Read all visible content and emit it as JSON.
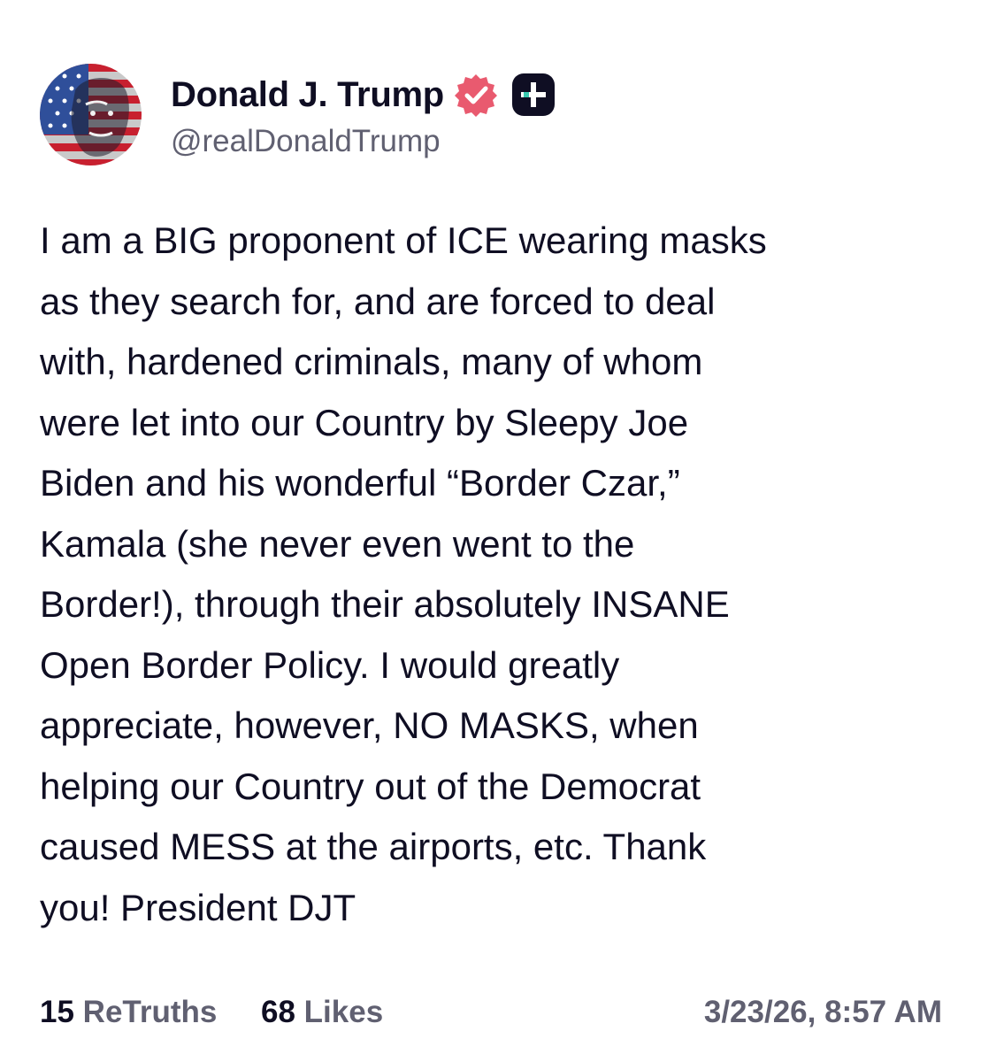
{
  "author": {
    "display_name": "Donald J. Trump",
    "handle": "@realDonaldTrump",
    "avatar_icon": "flag-portrait-avatar",
    "verified_icon": "verified-badge-icon",
    "plus_icon": "truth-plus-icon"
  },
  "post": {
    "text": "I am a BIG proponent of ICE wearing masks\nas they search for, and are forced to deal\nwith, hardened criminals, many of whom\nwere let into our Country by Sleepy Joe\nBiden and his wonderful “Border Czar,”\nKamala (she never even went to the\nBorder!), through their absolutely INSANE\nOpen Border Policy. I would greatly\nappreciate, however, NO MASKS, when\nhelping our Country out of the Democrat\ncaused MESS at the airports, etc. Thank\nyou! President DJT"
  },
  "stats": {
    "retruths_count": "15",
    "retruths_label": "ReTruths",
    "likes_count": "68",
    "likes_label": "Likes",
    "timestamp": "3/23/26, 8:57 AM"
  },
  "colors": {
    "text": "#0f0e23",
    "muted": "#606071",
    "verified": "#e95a6f",
    "plus_badge": "#0f0e23",
    "plus_accent": "#39c9b0"
  }
}
